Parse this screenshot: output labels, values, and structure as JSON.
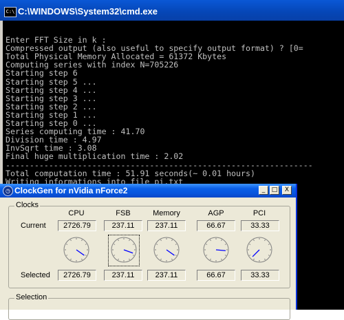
{
  "cmd": {
    "title": "C:\\WINDOWS\\System32\\cmd.exe",
    "icon_label": "C:\\",
    "lines": [
      "",
      "Enter FFT Size in k :",
      "Compressed output (also useful to specify output format) ? [0=",
      "Total Physical Memory Allocated = 61372 Kbytes",
      "Computing series with index N=705226",
      "Starting step 6",
      "Starting step 5 ...",
      "Starting step 4 ...",
      "Starting step 3 ...",
      "Starting step 2 ...",
      "Starting step 1 ...",
      "Starting step 0 ...",
      "Series computing time : 41.70",
      "Division time : 4.97",
      "InvSqrt time : 3.08",
      "Final huge multiplication time : 2.02",
      "----------------------------------------------------------------",
      "Total computation time : 51.91 seconds(~ 0.01 hours)",
      "Writing informations into file pi.txt"
    ]
  },
  "clockgen": {
    "title": "ClockGen for nVidia nForce2",
    "buttons": {
      "minimize": "_",
      "maximize": "□",
      "close": "X"
    },
    "clocks_label": "Clocks",
    "selection_label": "Selection",
    "row_current": "Current",
    "row_selected": "Selected",
    "columns": [
      {
        "key": "cpu",
        "label": "CPU",
        "current": "2726.79",
        "selected": "2726.79"
      },
      {
        "key": "fsb",
        "label": "FSB",
        "current": "237.11",
        "selected": "237.11"
      },
      {
        "key": "memory",
        "label": "Memory",
        "current": "237.11",
        "selected": "237.11"
      },
      {
        "key": "agp",
        "label": "AGP",
        "current": "66.67",
        "selected": "66.67"
      },
      {
        "key": "pci",
        "label": "PCI",
        "current": "33.33",
        "selected": "33.33"
      }
    ],
    "gauge_angles_deg": [
      125,
      110,
      125,
      95,
      225
    ],
    "needle_color": "#0000ff"
  }
}
